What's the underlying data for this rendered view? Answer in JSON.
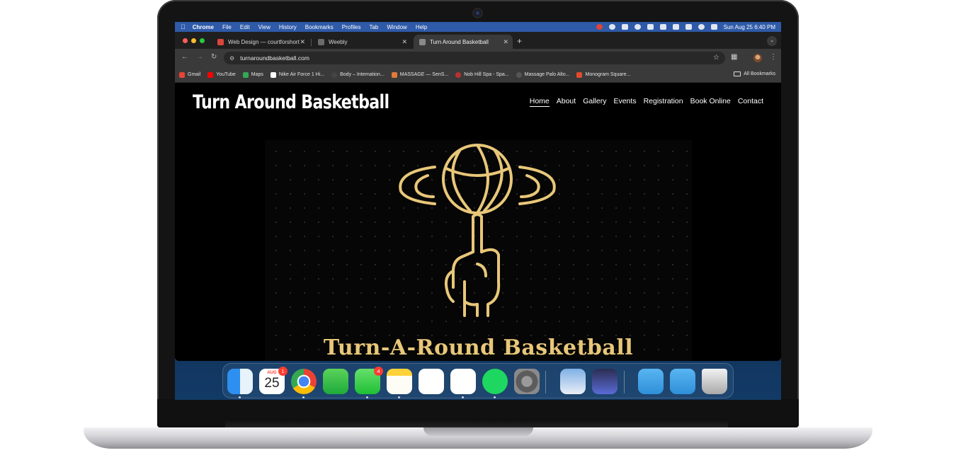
{
  "menubar": {
    "app": "Chrome",
    "items": [
      "File",
      "Edit",
      "View",
      "History",
      "Bookmarks",
      "Profiles",
      "Tab",
      "Window",
      "Help"
    ],
    "clock": "Sun Aug 25  6:40 PM"
  },
  "tabs": [
    {
      "title": "Web Design — courtforshort",
      "favicon_color": "#d9473b"
    },
    {
      "title": "Weebly",
      "favicon_color": "#6b6b6b"
    },
    {
      "title": "Turn Around Basketball",
      "favicon_color": "#8a8a8a"
    }
  ],
  "address_bar": {
    "url": "turnaroundbasketball.com"
  },
  "bookmarks": [
    {
      "label": "Gmail",
      "color": "#ea4335"
    },
    {
      "label": "YouTube",
      "color": "#ff0000"
    },
    {
      "label": "Maps",
      "color": "#34a853"
    },
    {
      "label": "Nike Air Force 1 Hi...",
      "color": "#ffffff"
    },
    {
      "label": "Body – Internation...",
      "color": "#444444"
    },
    {
      "label": "MASSAGE — SenS...",
      "color": "#e07a3b"
    },
    {
      "label": "Nob Hill Spa - Spa...",
      "color": "#b8312f"
    },
    {
      "label": "Massage Palo Alto...",
      "color": "#555555"
    },
    {
      "label": "Monogram Square...",
      "color": "#e24a2c"
    }
  ],
  "all_bookmarks": "All Bookmarks",
  "site": {
    "title": "Turn Around Basketball",
    "nav": [
      "Home",
      "About",
      "Gallery",
      "Events",
      "Registration",
      "Book Online",
      "Contact"
    ],
    "hero_text": "Turn-A-Round Basketball",
    "accent_color": "#e8c779"
  },
  "dock": {
    "calendar": {
      "month": "AUG",
      "day": "25",
      "badge": "1"
    },
    "messages_badge": "4"
  }
}
